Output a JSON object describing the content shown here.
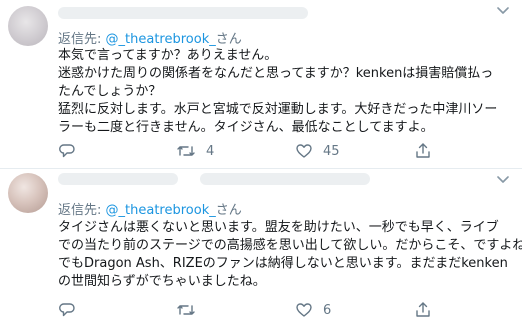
{
  "tweets": [
    {
      "reply_prefix": "返信先: ",
      "reply_handle": "@_theatrebrook_",
      "reply_suffix": "さん",
      "lines": [
        "本気で言ってますか？ありえません。",
        "迷惑かけた周りの関係者をなんだと思ってますか？kenkenは損害賠償払っ",
        "たんでしょうか？",
        "猛烈に反対します。水戸と宮城で反対運動します。大好きだった中津川ソー",
        "ラーも二度と行きません。タイジさん、最低なことしてますよ。"
      ],
      "retweets": "4",
      "likes": "45"
    },
    {
      "reply_prefix": "返信先: ",
      "reply_handle": "@_theatrebrook_",
      "reply_suffix": "さん",
      "lines": [
        "タイジさんは悪くないと思います。盟友を助けたい、一秒でも早く、ライブ",
        "での当たり前のステージでの高揚感を思い出して欲しい。だからこそ、ですよね。",
        "でもDragon Ash、RIZEのファンは納得しないと思います。まだまだkenken",
        "の世間知らずがでちゃいましたね。"
      ],
      "retweets": "",
      "likes": "6"
    }
  ],
  "icons": [
    "reply-icon",
    "retweet-icon",
    "like-icon",
    "share-icon",
    "caret-down-icon"
  ],
  "colors": {
    "link": "#1b95e0",
    "muted": "#657786",
    "text": "#14171a",
    "divider": "#e6ecf0"
  }
}
